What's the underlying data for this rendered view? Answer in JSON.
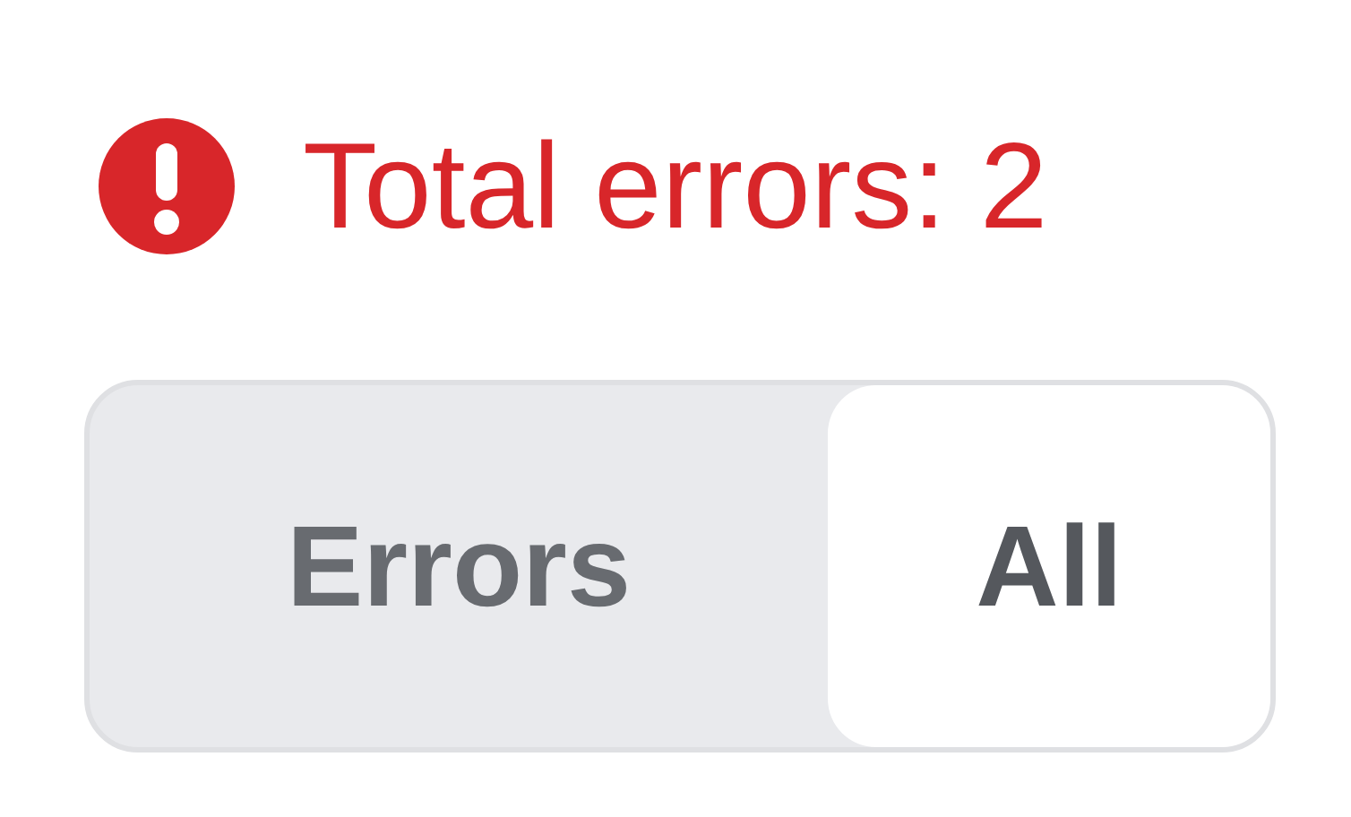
{
  "status": {
    "text": "Total errors: 2"
  },
  "segments": [
    {
      "label": "Errors",
      "selected": false
    },
    {
      "label": "All",
      "selected": true
    }
  ]
}
